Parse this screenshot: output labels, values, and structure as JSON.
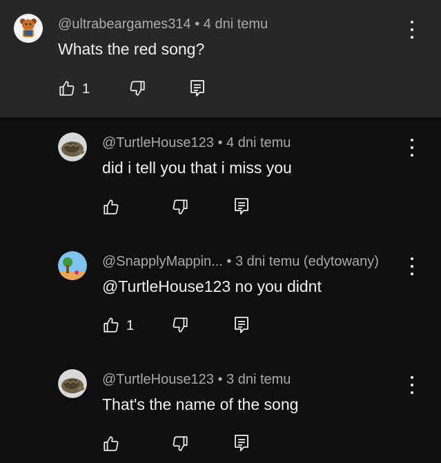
{
  "comments": [
    {
      "author": "@ultrabeargames314",
      "sep": "•",
      "time": "4 dni temu",
      "text": "Whats the red song?",
      "likes": "1"
    },
    {
      "author": "@TurtleHouse123",
      "sep": "•",
      "time": "4 dni temu",
      "text": "did i tell you that i miss you",
      "likes": ""
    },
    {
      "author": "@SnapplyMappin...",
      "sep": "•",
      "time": "3 dni temu (edytowany)",
      "text": "@TurtleHouse123 no you didnt",
      "likes": "1"
    },
    {
      "author": "@TurtleHouse123",
      "sep": "•",
      "time": "3 dni temu",
      "text": "That's the name of the song",
      "likes": ""
    }
  ],
  "icons": {
    "like": "thumb-up-icon",
    "dislike": "thumb-down-icon",
    "reply": "reply-icon",
    "menu": "more-vert-icon"
  },
  "colors": {
    "background": "#0f0f0f",
    "highlight": "#272727",
    "meta": "#aaaaaa",
    "text": "#f1f1f1"
  }
}
